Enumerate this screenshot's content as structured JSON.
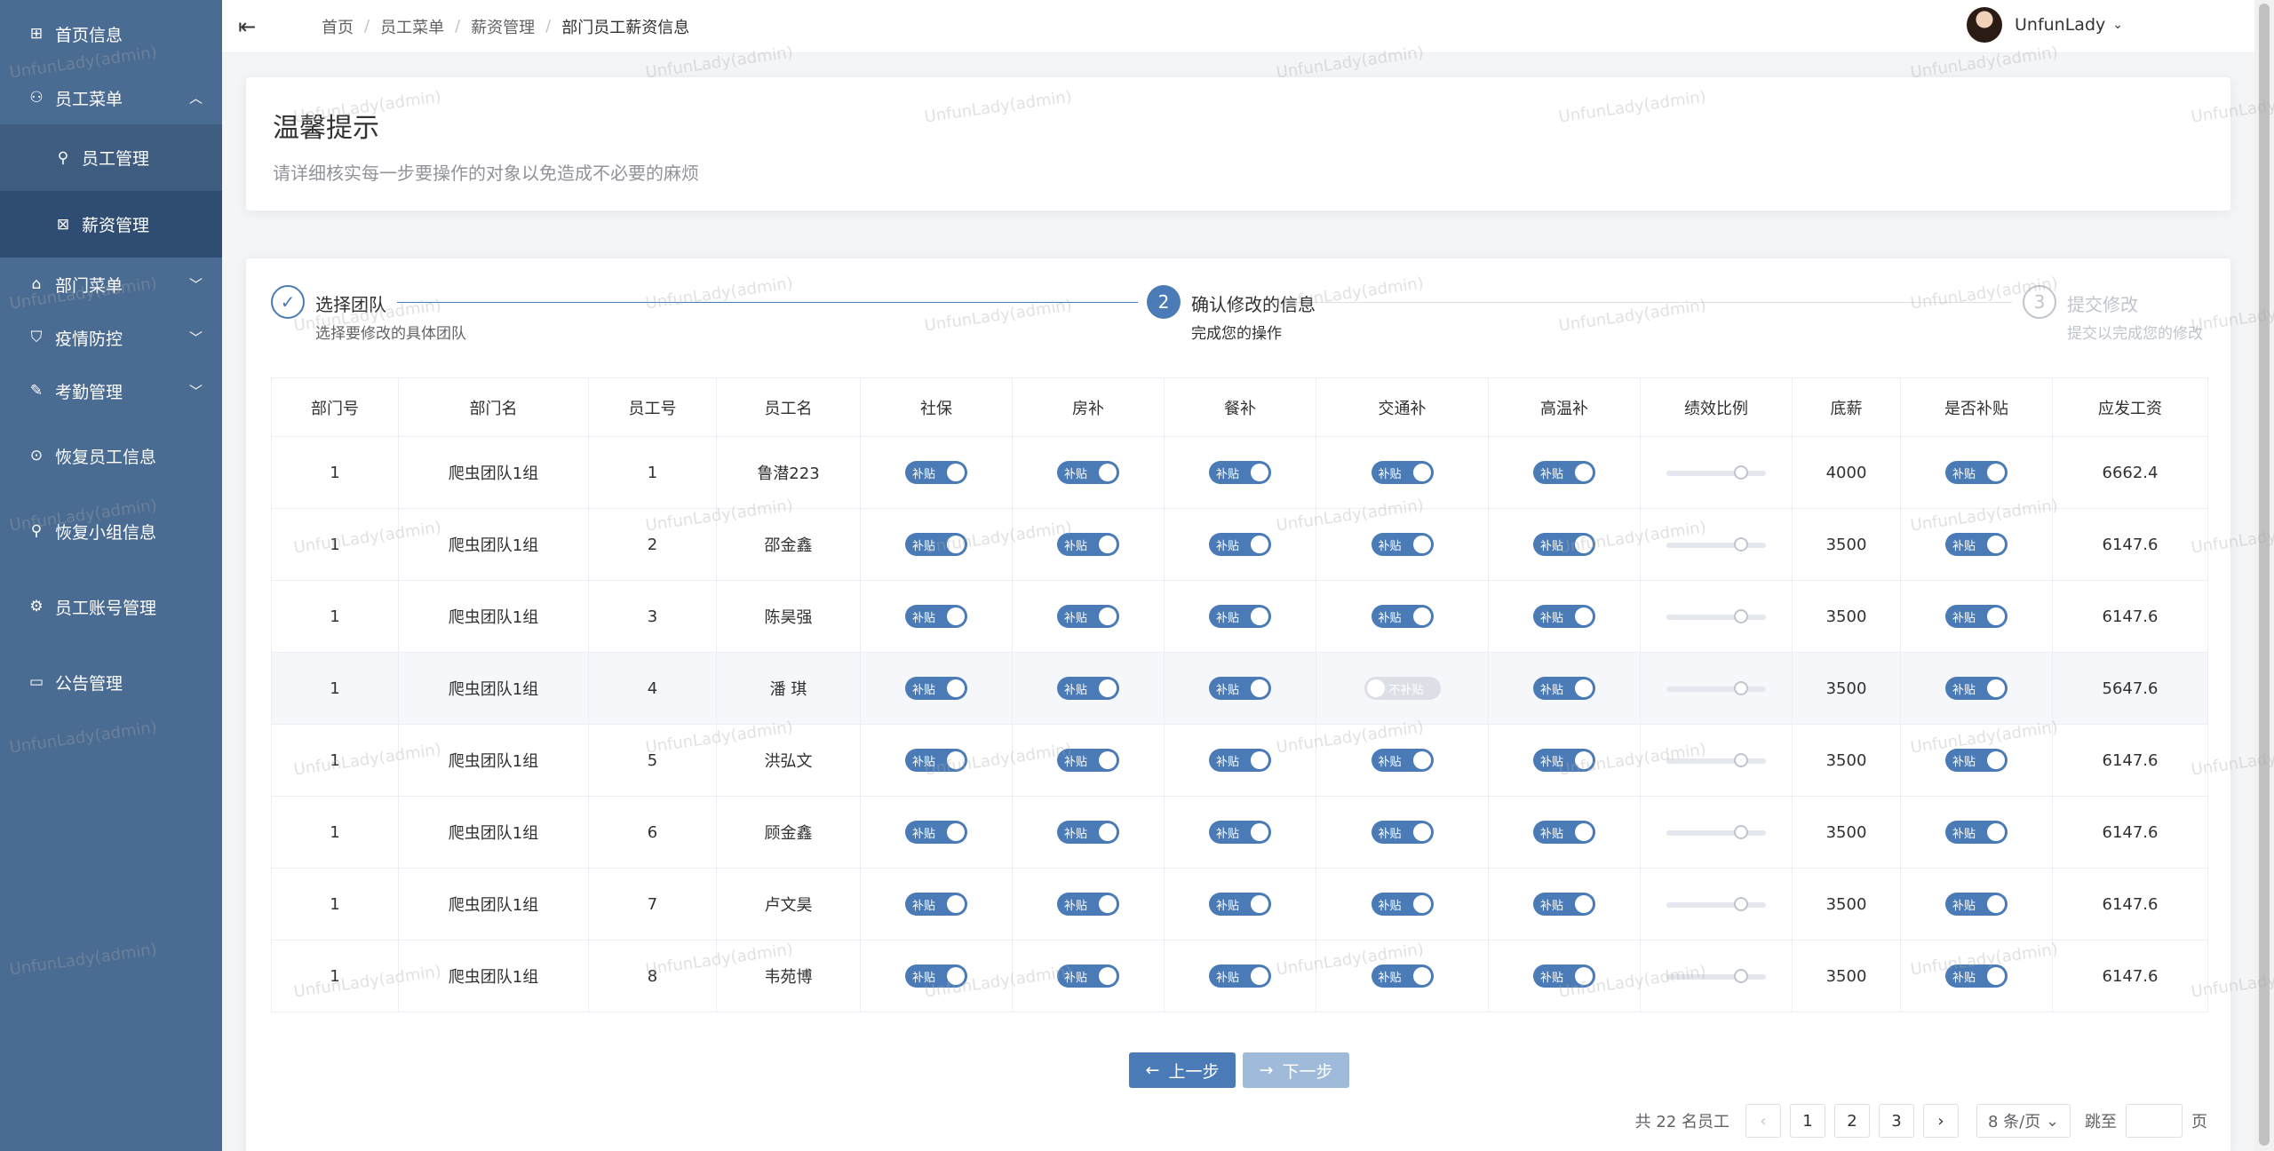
{
  "sidebar": {
    "items": [
      {
        "icon": "grid-icon",
        "icon_glyph": "⊞",
        "label": "首页信息"
      },
      {
        "icon": "user-group-icon",
        "icon_glyph": "⚇",
        "label": "员工菜单",
        "expanded": true,
        "children": [
          {
            "icon": "user-icon",
            "icon_glyph": "⚲",
            "label": "员工管理"
          },
          {
            "icon": "salary-icon",
            "icon_glyph": "⊠",
            "label": "薪资管理",
            "active": true
          }
        ]
      },
      {
        "icon": "home-icon",
        "icon_glyph": "⌂",
        "label": "部门菜单"
      },
      {
        "icon": "shield-icon",
        "icon_glyph": "⛉",
        "label": "疫情防控"
      },
      {
        "icon": "pen-icon",
        "icon_glyph": "✎",
        "label": "考勤管理"
      },
      {
        "icon": "clock-icon",
        "icon_glyph": "⊙",
        "label": "恢复员工信息"
      },
      {
        "icon": "user-restore-icon",
        "icon_glyph": "⚲",
        "label": "恢复小组信息"
      },
      {
        "icon": "gear-icon",
        "icon_glyph": "⚙",
        "label": "员工账号管理"
      },
      {
        "icon": "monitor-icon",
        "icon_glyph": "▭",
        "label": "公告管理"
      }
    ]
  },
  "header": {
    "fold_icon": "menu-fold-icon",
    "breadcrumb": [
      "首页",
      "员工菜单",
      "薪资管理",
      "部门员工薪资信息"
    ],
    "user_name": "UnfunLady"
  },
  "tip": {
    "title": "温馨提示",
    "description": "请详细核实每一步要操作的对象以免造成不必要的麻烦"
  },
  "steps": [
    {
      "number": "",
      "title": "选择团队",
      "description": "选择要修改的具体团队",
      "status": "finished"
    },
    {
      "number": "2",
      "title": "确认修改的信息",
      "description": "完成您的操作",
      "status": "process"
    },
    {
      "number": "3",
      "title": "提交修改",
      "description": "提交以完成您的修改",
      "status": "wait"
    }
  ],
  "table": {
    "headers": [
      "部门号",
      "部门名",
      "员工号",
      "员工名",
      "社保",
      "房补",
      "餐补",
      "交通补",
      "高温补",
      "绩效比例",
      "底薪",
      "是否补贴",
      "应发工资"
    ],
    "switch_on_text": "补贴",
    "switch_off_text": "不补贴",
    "rows": [
      {
        "dept_id": "1",
        "dept_name": "爬虫团队1组",
        "emp_id": "1",
        "emp_name": "鲁潜223",
        "social": true,
        "housing": true,
        "meal": true,
        "traffic": true,
        "heat": true,
        "perf": 0.75,
        "base": "4000",
        "subsidy": true,
        "pay": "6662.4"
      },
      {
        "dept_id": "1",
        "dept_name": "爬虫团队1组",
        "emp_id": "2",
        "emp_name": "邵金鑫",
        "social": true,
        "housing": true,
        "meal": true,
        "traffic": true,
        "heat": true,
        "perf": 0.75,
        "base": "3500",
        "subsidy": true,
        "pay": "6147.6"
      },
      {
        "dept_id": "1",
        "dept_name": "爬虫团队1组",
        "emp_id": "3",
        "emp_name": "陈昊强",
        "social": true,
        "housing": true,
        "meal": true,
        "traffic": true,
        "heat": true,
        "perf": 0.75,
        "base": "3500",
        "subsidy": true,
        "pay": "6147.6"
      },
      {
        "dept_id": "1",
        "dept_name": "爬虫团队1组",
        "emp_id": "4",
        "emp_name": "潘 琪",
        "social": true,
        "housing": true,
        "meal": true,
        "traffic": false,
        "heat": true,
        "perf": 0.75,
        "base": "3500",
        "subsidy": true,
        "pay": "5647.6",
        "highlight": true
      },
      {
        "dept_id": "1",
        "dept_name": "爬虫团队1组",
        "emp_id": "5",
        "emp_name": "洪弘文",
        "social": true,
        "housing": true,
        "meal": true,
        "traffic": true,
        "heat": true,
        "perf": 0.75,
        "base": "3500",
        "subsidy": true,
        "pay": "6147.6"
      },
      {
        "dept_id": "1",
        "dept_name": "爬虫团队1组",
        "emp_id": "6",
        "emp_name": "顾金鑫",
        "social": true,
        "housing": true,
        "meal": true,
        "traffic": true,
        "heat": true,
        "perf": 0.75,
        "base": "3500",
        "subsidy": true,
        "pay": "6147.6"
      },
      {
        "dept_id": "1",
        "dept_name": "爬虫团队1组",
        "emp_id": "7",
        "emp_name": "卢文昊",
        "social": true,
        "housing": true,
        "meal": true,
        "traffic": true,
        "heat": true,
        "perf": 0.75,
        "base": "3500",
        "subsidy": true,
        "pay": "6147.6"
      },
      {
        "dept_id": "1",
        "dept_name": "爬虫团队1组",
        "emp_id": "8",
        "emp_name": "韦苑博",
        "social": true,
        "housing": true,
        "meal": true,
        "traffic": true,
        "heat": true,
        "perf": 0.75,
        "base": "3500",
        "subsidy": true,
        "pay": "6147.6"
      }
    ]
  },
  "buttons": {
    "prev": "上一步",
    "next": "下一步"
  },
  "pagination": {
    "total": "共 22 名员工",
    "pages": [
      "1",
      "2",
      "3"
    ],
    "page_size": "8 条/页",
    "jump_label": "跳至",
    "page_suffix": "页"
  },
  "watermark": "UnfunLady(admin)",
  "colors": {
    "sidebar": "#4a6b92",
    "primary": "#4a7bb7",
    "switch_off": "#dcdfe6"
  }
}
